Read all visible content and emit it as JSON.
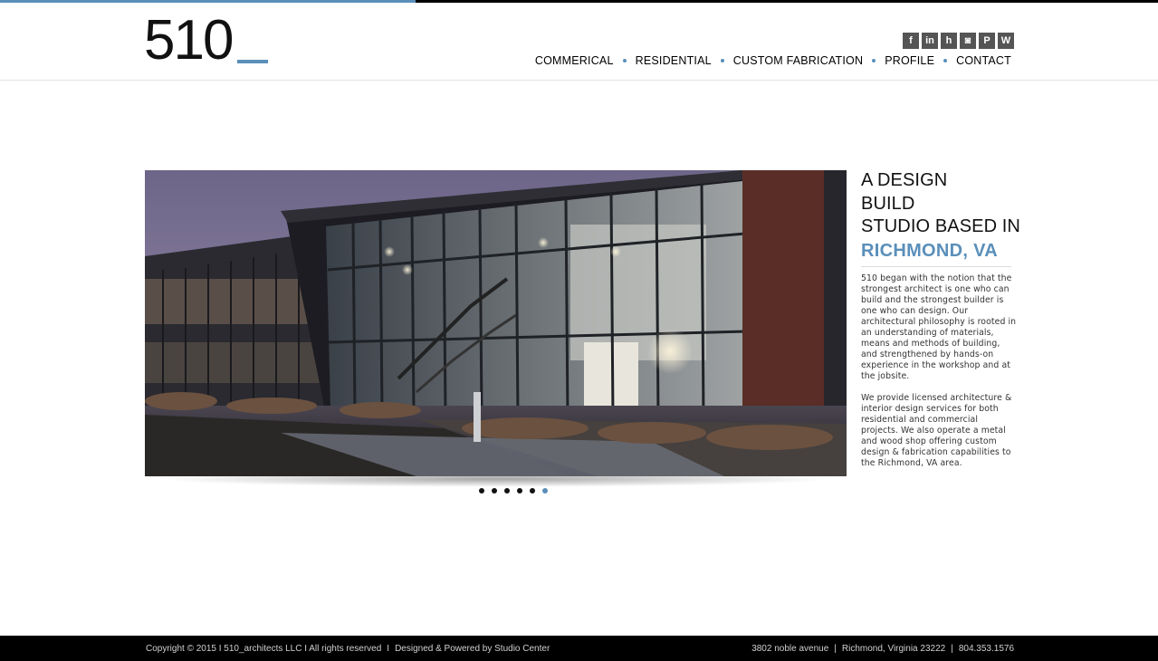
{
  "logo": {
    "text": "510"
  },
  "social": [
    {
      "icon": "facebook-icon",
      "glyph": "f"
    },
    {
      "icon": "linkedin-icon",
      "glyph": "in"
    },
    {
      "icon": "houzz-icon",
      "glyph": "h"
    },
    {
      "icon": "instagram-icon",
      "glyph": "◙"
    },
    {
      "icon": "pinterest-icon",
      "glyph": "P"
    },
    {
      "icon": "wordpress-icon",
      "glyph": "W"
    }
  ],
  "nav": {
    "items": [
      {
        "label": "COMMERICAL"
      },
      {
        "label": "RESIDENTIAL"
      },
      {
        "label": "CUSTOM FABRICATION"
      },
      {
        "label": "PROFILE"
      },
      {
        "label": "CONTACT"
      }
    ]
  },
  "slider": {
    "count": 6,
    "active_index": 5
  },
  "intro": {
    "line1": "A DESIGN",
    "line2": "BUILD",
    "line3": "STUDIO BASED IN",
    "city": "RICHMOND, VA",
    "para1": "510 began with the notion that the strongest architect is one who can build and the strongest builder is one who can design. Our architectural philosophy is rooted in an understanding of materials, means and methods of building, and strengthened by hands-on experience in the workshop and at the jobsite.",
    "para2": "We provide licensed architecture & interior design services for both residential and commercial projects. We also operate a metal and wood shop offering custom design & fabrication capabilities to the Richmond, VA area."
  },
  "footer": {
    "copyright": "Copyright © 2015 I 510_architects LLC I All rights reserved",
    "separator": "I",
    "credit": "Designed & Powered by Studio Center",
    "address": "3802 noble avenue",
    "city": "Richmond, Virginia 23222",
    "phone": "804.353.1576",
    "pipe": "|"
  },
  "colors": {
    "accent": "#5a8fba",
    "footer_bg": "#000000",
    "text": "#111111"
  }
}
